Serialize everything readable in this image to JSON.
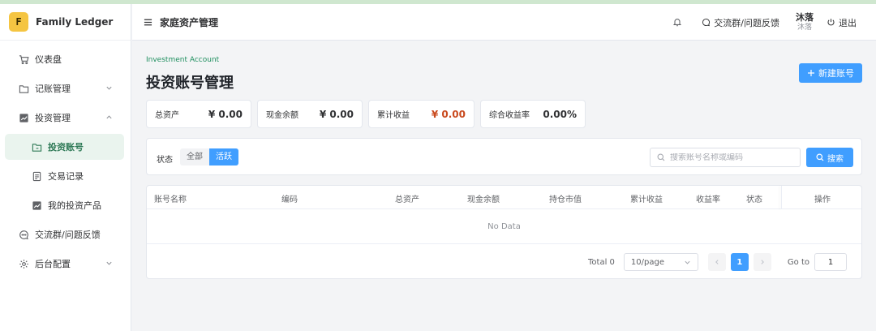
{
  "brand": {
    "logo_letter": "F",
    "name": "Family Ledger"
  },
  "sidebar": {
    "items": [
      {
        "label": "仪表盘",
        "icon": "cart-icon"
      },
      {
        "label": "记账管理",
        "icon": "folder-icon",
        "expandable": true
      },
      {
        "label": "投资管理",
        "icon": "chart-icon",
        "expandable": true,
        "expanded": true
      },
      {
        "label": "投资账号",
        "icon": "folder-icon",
        "active": true,
        "sub": true
      },
      {
        "label": "交易记录",
        "icon": "document-icon",
        "sub": true
      },
      {
        "label": "我的投资产品",
        "icon": "chart-icon",
        "sub": true
      },
      {
        "label": "交流群/问题反馈",
        "icon": "chat-icon"
      },
      {
        "label": "后台配置",
        "icon": "gear-icon",
        "expandable": true
      }
    ]
  },
  "header": {
    "title": "家庭资产管理",
    "feedback": "交流群/问题反馈",
    "user_name": "沐落",
    "user_sub": "沐落",
    "logout": "退出"
  },
  "page": {
    "kicker": "Investment Account",
    "title": "投资账号管理",
    "new_button": "新建账号"
  },
  "stats": [
    {
      "label": "总资产",
      "value": "¥ 0.00"
    },
    {
      "label": "现金余额",
      "value": "¥ 0.00"
    },
    {
      "label": "累计收益",
      "value": "¥ 0.00"
    },
    {
      "label": "综合收益率",
      "value": "0.00%"
    }
  ],
  "filter": {
    "status_label": "状态",
    "options": [
      "全部",
      "活跃"
    ],
    "selected": "活跃",
    "search_placeholder": "搜索账号名称或编码",
    "search_value": "",
    "search_button": "搜索"
  },
  "table": {
    "columns": [
      "账号名称",
      "编码",
      "总资产",
      "现金余额",
      "持仓市值",
      "累计收益",
      "收益率",
      "状态",
      "操作"
    ],
    "empty_text": "No Data"
  },
  "pagination": {
    "total": "Total 0",
    "page_size": "10/page",
    "current_page": "1",
    "goto_label": "Go to",
    "goto_value": "1"
  },
  "colors": {
    "primary": "#409eff",
    "accent_green": "#1f8f5f",
    "profit_red": "#c94a1e"
  }
}
